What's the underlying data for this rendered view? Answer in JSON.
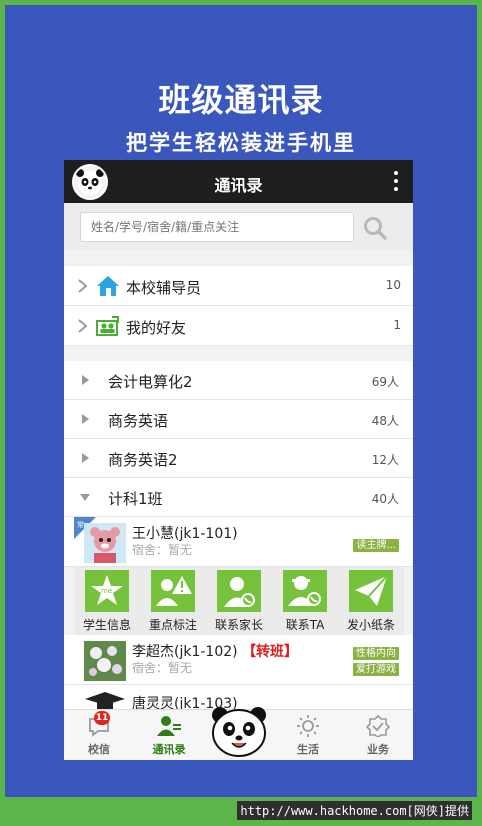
{
  "promo": {
    "title": "班级通讯录",
    "subtitle": "把学生轻松装进手机里"
  },
  "app": {
    "title": "通讯录",
    "search_placeholder": "姓名/学号/宿舍/籍/重点关注"
  },
  "groups": [
    {
      "label": "本校辅导员",
      "count": "10",
      "icon": "house-icon"
    },
    {
      "label": "我的好友",
      "count": "1",
      "icon": "friends-icon"
    }
  ],
  "classes": [
    {
      "label": "会计电算化2",
      "count": "69人",
      "expanded": false
    },
    {
      "label": "商务英语",
      "count": "48人",
      "expanded": false
    },
    {
      "label": "商务英语2",
      "count": "12人",
      "expanded": false
    },
    {
      "label": "计科1班",
      "count": "40人",
      "expanded": true
    }
  ],
  "students": [
    {
      "name": "王小慧(jk1-101)",
      "dorm": "宿舍：暂无",
      "tags": [
        "读主牌..."
      ],
      "corner_label": "常"
    },
    {
      "name": "李超杰(jk1-102)",
      "badge": "【转班】",
      "dorm": "宿舍：暂无",
      "tags": [
        "性格内向",
        "爱打游戏"
      ]
    },
    {
      "name": "唐灵灵(jk1-103)"
    }
  ],
  "actions": [
    {
      "label": "学生信息",
      "icon": "student-info-icon"
    },
    {
      "label": "重点标注",
      "icon": "alert-mark-icon"
    },
    {
      "label": "联系家长",
      "icon": "contact-parent-icon"
    },
    {
      "label": "联系TA",
      "icon": "contact-ta-icon"
    },
    {
      "label": "发小纸条",
      "icon": "paper-plane-icon"
    }
  ],
  "tabs": [
    {
      "label": "校信",
      "badge": "11",
      "icon": "chat-bubble-icon",
      "active": false
    },
    {
      "label": "通讯录",
      "icon": "contacts-icon",
      "active": true
    },
    {
      "label": "生活",
      "icon": "sun-icon",
      "active": false
    },
    {
      "label": "业务",
      "icon": "badge-check-icon",
      "active": false
    }
  ],
  "footer": {
    "url_text": "http://www.hackhome.com",
    "credit": "[网侠]提供"
  },
  "colors": {
    "frame_green": "#5bb548",
    "promo_blue": "#3a57be",
    "topbar": "#1e1e1e",
    "accent_green": "#77c23d",
    "tag_green": "#8ab343",
    "alert_red": "#e21b1b"
  }
}
